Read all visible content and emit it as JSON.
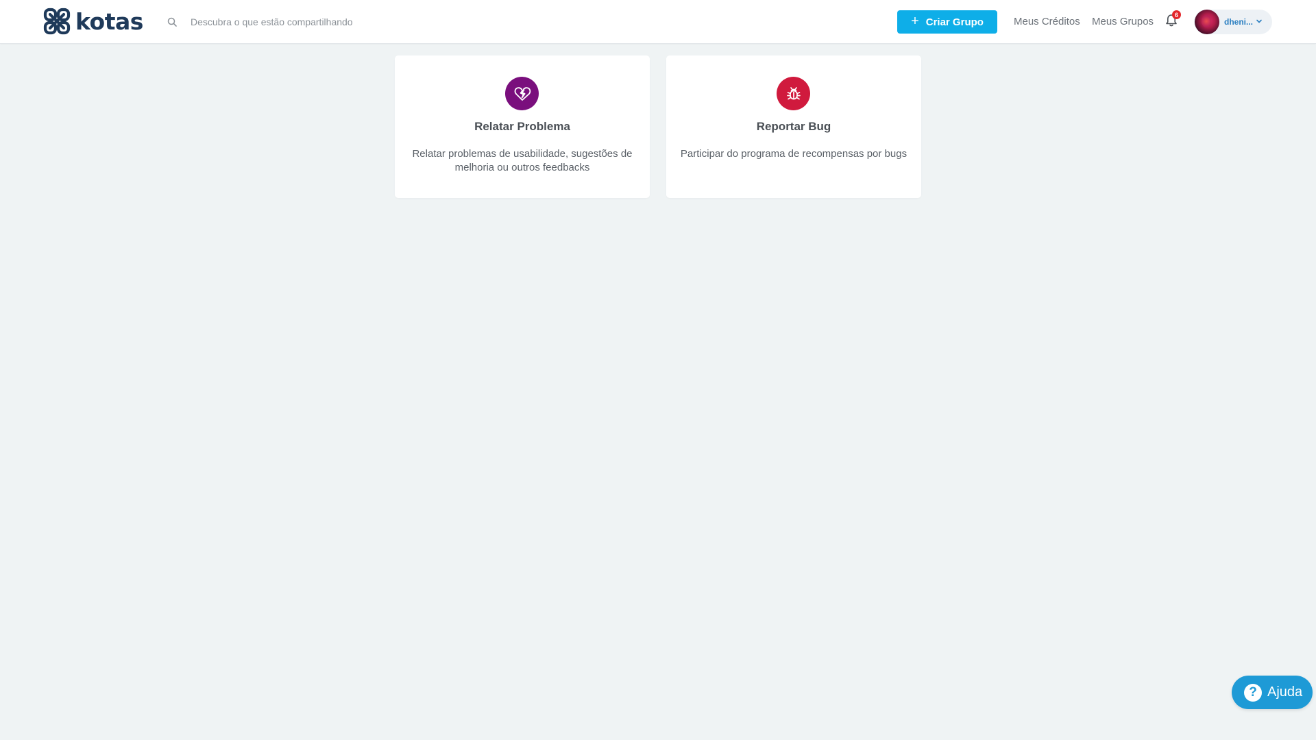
{
  "header": {
    "logo_text": "kotas",
    "search": {
      "placeholder": "Descubra o que estão compartilhando",
      "value": ""
    },
    "create_group_label": "Criar Grupo",
    "nav": {
      "credits_label": "Meus Créditos",
      "groups_label": "Meus Grupos"
    },
    "notifications": {
      "count": "6"
    },
    "user": {
      "name": "dheni..."
    }
  },
  "cards": [
    {
      "title": "Relatar Problema",
      "description": "Relatar problemas de usabilidade, sugestões de melhoria ou outros feedbacks",
      "icon": "broken-heart-icon",
      "color": "#7a0f7d"
    },
    {
      "title": "Reportar Bug",
      "description": "Participar do programa de recompensas por bugs",
      "icon": "bug-icon",
      "color": "#d01a3d"
    }
  ],
  "help": {
    "label": "Ajuda",
    "icon": "question-icon"
  },
  "colors": {
    "primary": "#0eaee8",
    "brand": "#1f3a5a",
    "background": "#eff3f4",
    "badge": "#e3262b",
    "help": "#1e9ad6"
  }
}
